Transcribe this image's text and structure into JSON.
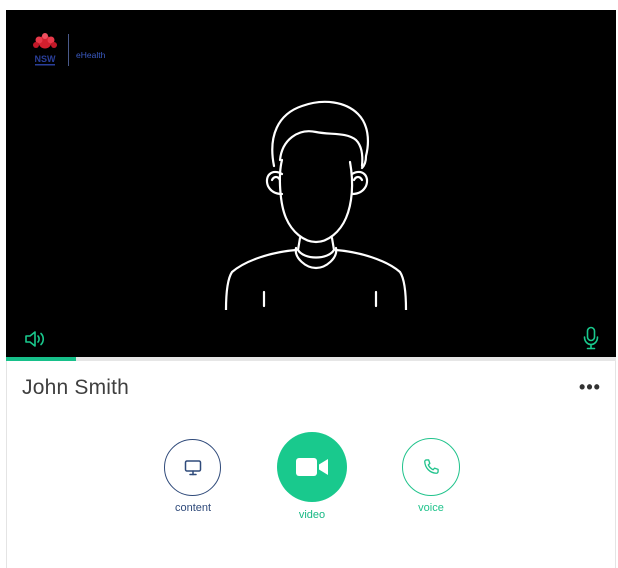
{
  "branding": {
    "org_mark": "NSW",
    "product": "eHealth"
  },
  "video": {
    "placeholder_icon": "person-silhouette-icon",
    "speaker_icon": "speaker-volume-icon",
    "mic_icon": "microphone-icon",
    "progress": 0.115
  },
  "participant": {
    "name": "John Smith"
  },
  "menu": {
    "more_label": "•••"
  },
  "actions": {
    "content": {
      "label": "content",
      "icon": "monitor-icon"
    },
    "video": {
      "label": "video",
      "icon": "video-camera-icon"
    },
    "voice": {
      "label": "voice",
      "icon": "phone-icon"
    }
  },
  "colors": {
    "accent_green": "#19c98d",
    "navy": "#2f4a7a",
    "video_background": "#000000"
  }
}
